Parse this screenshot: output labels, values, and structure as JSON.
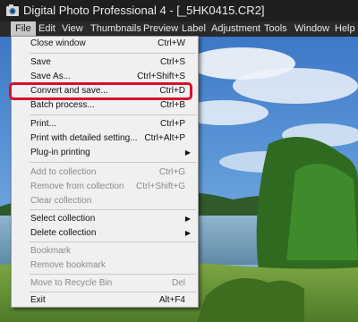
{
  "window": {
    "title": "Digital Photo Professional 4 - [_5HK0415.CR2]"
  },
  "menubar": [
    {
      "id": "file",
      "label": "File"
    },
    {
      "id": "edit",
      "label": "Edit"
    },
    {
      "id": "view",
      "label": "View"
    },
    {
      "id": "thumbnails",
      "label": "Thumbnails"
    },
    {
      "id": "preview",
      "label": "Preview"
    },
    {
      "id": "label",
      "label": "Label"
    },
    {
      "id": "adjustment",
      "label": "Adjustment"
    },
    {
      "id": "tools",
      "label": "Tools"
    },
    {
      "id": "window",
      "label": "Window"
    },
    {
      "id": "help",
      "label": "Help"
    }
  ],
  "file_menu": {
    "close_window": {
      "label": "Close window",
      "shortcut": "Ctrl+W"
    },
    "save": {
      "label": "Save",
      "shortcut": "Ctrl+S"
    },
    "save_as": {
      "label": "Save As...",
      "shortcut": "Ctrl+Shift+S"
    },
    "convert_and_save": {
      "label": "Convert and save...",
      "shortcut": "Ctrl+D"
    },
    "batch_process": {
      "label": "Batch process...",
      "shortcut": "Ctrl+B"
    },
    "print": {
      "label": "Print...",
      "shortcut": "Ctrl+P"
    },
    "print_detailed": {
      "label": "Print with detailed setting...",
      "shortcut": "Ctrl+Alt+P"
    },
    "plugin_printing": {
      "label": "Plug-in printing"
    },
    "add_to_collection": {
      "label": "Add to collection",
      "shortcut": "Ctrl+G"
    },
    "remove_from_collection": {
      "label": "Remove from collection",
      "shortcut": "Ctrl+Shift+G"
    },
    "clear_collection": {
      "label": "Clear collection"
    },
    "select_collection": {
      "label": "Select collection"
    },
    "delete_collection": {
      "label": "Delete collection"
    },
    "bookmark": {
      "label": "Bookmark"
    },
    "remove_bookmark": {
      "label": "Remove bookmark"
    },
    "move_to_recycle_bin": {
      "label": "Move to Recycle Bin",
      "shortcut": "Del"
    },
    "exit": {
      "label": "Exit",
      "shortcut": "Alt+F4"
    }
  },
  "colors": {
    "highlight": "#d8102a",
    "menu_bg": "#f0f0f0",
    "titlebar_bg": "#1f1f1f"
  }
}
